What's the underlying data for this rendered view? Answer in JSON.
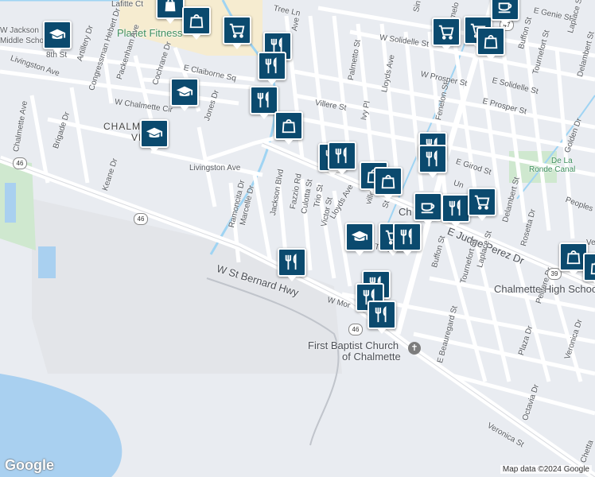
{
  "map": {
    "attribution": "Map data ©2024 Google",
    "logo": "Google",
    "labels": {
      "planet_fitness": "Planet Fitness",
      "chalmette_vista_1": "CHALMETTE",
      "chalmette_vista_2": "VISTA",
      "livingston_ave": "Livingston Ave",
      "livingston_ave_w": "Livingston Ave",
      "w_st_bernard_hwy": "W St Bernard Hwy",
      "e_judge_perez": "E Judge Perez Dr",
      "chalmette_high": "Chalmette High School",
      "first_baptist_1": "First Baptist Church",
      "first_baptist_2": "of Chalmette",
      "de_la_ronde_1": "De La",
      "de_la_ronde_2": "Ronde Canal",
      "lafitte_ct": "Lafitte Ct",
      "eighth_st": "8th St",
      "artillery_dr": "Artillery Dr",
      "congressman_hebert": "Congressman Hebert Dr",
      "packenham_ave": "Packenham Ave",
      "cochrane_dr": "Cochrane Dr",
      "w_chalmette_cir": "W Chalmette Cir",
      "jones_dr": "Jones Dr",
      "e_claiborne_sq": "E Claiborne Sq",
      "chalmette_ave": "Chalmette Ave",
      "brigade_dr": "Brigade Dr",
      "keane_dr": "Keane Dr",
      "ramoncita_dr": "Ramoncita Dr",
      "marcelle_dr": "Marcelle Dr",
      "jackson_blvd": "Jackson Blvd",
      "fazzio_rd": "Fazzio Rd",
      "culotta_st": "Culotta St",
      "trio_st": "Trio St",
      "victor_st": "Victor St",
      "lloyds_ave": "Lloyds Ave",
      "lloyds_ave_n": "Lloyds Ave",
      "villere_st": "Villere St",
      "ivy_pl": "Ivy Pl",
      "palmetto_st": "Palmetto St",
      "w_solidelle_st": "W Solidelle St",
      "w_prosper_st": "W Prosper St",
      "fenelon_st": "Fenelon St",
      "e_solidelle_st": "E Solidelle St",
      "e_prosper_st": "E Prosper St",
      "e_girod_st": "E Girod St",
      "buffon_st_n": "Buffon St",
      "tournefort_st_n": "Tournefort St",
      "e_genie_st": "E Genie St",
      "laplace_st_n": "Laplace St",
      "delambert_st_n": "Delambert St",
      "golden_dr": "Golden Dr",
      "peoples": "Peoples",
      "delambert_st": "Delambert St",
      "rosetta_dr": "Rosetta Dr",
      "buffon_st": "Buffon St",
      "tournefort_st": "Tournefort St",
      "laplace_st": "Laplace St",
      "pelitere_dr": "Pelitere Dr",
      "e_beauregard_st": "E Beauregard St",
      "plaza_dr": "Plaza Dr",
      "octavia_dr": "Octavia Dr",
      "veronica_dr": "Veronica Dr",
      "veronica_st": "Veronica St",
      "chetta": "Chetta",
      "w_mor": "W Mor",
      "trist": "Trist",
      "ville_st": "ville St",
      "tree_ln": "Tree Ln",
      "jackson_middle_1": "W Jackson",
      "jackson_middle_2": "Middle School",
      "sin": "Sin",
      "ch": "Ch",
      "un": "Un",
      "ve": "Ve",
      "ave": "Ave",
      "amelo": "amelo",
      "st": "St"
    },
    "shields": {
      "s46_w": "46",
      "s46_c": "46",
      "s46_s": "46",
      "s47": "47",
      "s39": "39"
    },
    "church_icon_glyph": "✝",
    "colors": {
      "pin_bg": "#0b4a6e",
      "water": "#a9d0f0",
      "canal": "#9fd4f3",
      "park": "#cfe8cf",
      "land": "#e9ecf1",
      "commercial": "#f6ecd0"
    },
    "markers": [
      {
        "id": "school-jackson",
        "icon": "school"
      },
      {
        "id": "shop-top-1",
        "icon": "shopping"
      },
      {
        "id": "shop-top-2",
        "icon": "bag"
      },
      {
        "id": "cart-top",
        "icon": "cart"
      },
      {
        "id": "restaurant-planet-1",
        "icon": "restaurant"
      },
      {
        "id": "restaurant-planet-2",
        "icon": "restaurant"
      },
      {
        "id": "school-claiborne",
        "icon": "school"
      },
      {
        "id": "restaurant-claiborne",
        "icon": "restaurant"
      },
      {
        "id": "shop-jackson",
        "icon": "bag"
      },
      {
        "id": "school-vista",
        "icon": "school"
      },
      {
        "id": "restaurant-culotta-1",
        "icon": "restaurant"
      },
      {
        "id": "restaurant-culotta-2",
        "icon": "restaurant"
      },
      {
        "id": "shop-lloyds",
        "icon": "bag"
      },
      {
        "id": "shop-lloyds-2",
        "icon": "bag"
      },
      {
        "id": "restaurant-girod",
        "icon": "restaurant"
      },
      {
        "id": "restaurant-girod-2",
        "icon": "restaurant"
      },
      {
        "id": "cafe-center",
        "icon": "cafe"
      },
      {
        "id": "restaurant-center",
        "icon": "restaurant"
      },
      {
        "id": "cart-center",
        "icon": "cart"
      },
      {
        "id": "cart-top-right",
        "icon": "cart"
      },
      {
        "id": "cart-top-right-2",
        "icon": "cart"
      },
      {
        "id": "bag-top-right",
        "icon": "bag"
      },
      {
        "id": "cafe-top-right",
        "icon": "cafe"
      },
      {
        "id": "school-trist",
        "icon": "school"
      },
      {
        "id": "cart-trist",
        "icon": "cart"
      },
      {
        "id": "restaurant-trist",
        "icon": "restaurant"
      },
      {
        "id": "restaurant-hwy",
        "icon": "restaurant"
      },
      {
        "id": "restaurant-mor-1",
        "icon": "restaurant"
      },
      {
        "id": "restaurant-mor-2",
        "icon": "restaurant"
      },
      {
        "id": "restaurant-mor-3",
        "icon": "restaurant"
      },
      {
        "id": "bag-right",
        "icon": "bag"
      },
      {
        "id": "bag-right-2",
        "icon": "bag"
      }
    ]
  }
}
